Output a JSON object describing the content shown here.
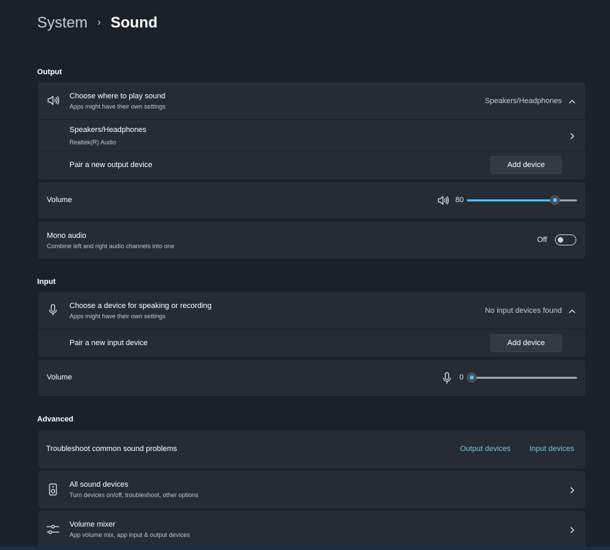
{
  "breadcrumb": {
    "parent": "System",
    "separator": "›",
    "current": "Sound"
  },
  "output": {
    "section_title": "Output",
    "choose": {
      "title": "Choose where to play sound",
      "subtitle": "Apps might have their own settings",
      "value": "Speakers/Headphones",
      "icon": "speaker-icon"
    },
    "device": {
      "title": "Speakers/Headphones",
      "subtitle": "Realtek(R) Audio"
    },
    "pair": {
      "title": "Pair a new output device",
      "button": "Add device"
    },
    "volume": {
      "label": "Volume",
      "value": "80",
      "level": 0.8,
      "icon": "speaker-icon"
    },
    "mono": {
      "title": "Mono audio",
      "subtitle": "Combine left and right audio channels into one",
      "state": "Off"
    }
  },
  "input": {
    "section_title": "Input",
    "choose": {
      "title": "Choose a device for speaking or recording",
      "subtitle": "Apps might have their own settings",
      "value": "No input devices found",
      "icon": "microphone-icon"
    },
    "pair": {
      "title": "Pair a new input device",
      "button": "Add device"
    },
    "volume": {
      "label": "Volume",
      "value": "0",
      "level": 0.0,
      "icon": "microphone-icon"
    }
  },
  "advanced": {
    "section_title": "Advanced",
    "troubleshoot": {
      "title": "Troubleshoot common sound problems",
      "link_output": "Output devices",
      "link_input": "Input devices"
    },
    "all_devices": {
      "title": "All sound devices",
      "subtitle": "Turn devices on/off, troubleshoot, other options",
      "icon": "speaker-box-icon"
    },
    "mixer": {
      "title": "Volume mixer",
      "subtitle": "App volume mix, app input & output devices",
      "icon": "mixer-icon"
    }
  },
  "colors": {
    "accent": "#4cc2ff",
    "link": "#6ec6f5",
    "card": "#262b34",
    "background": "#1b2029"
  }
}
